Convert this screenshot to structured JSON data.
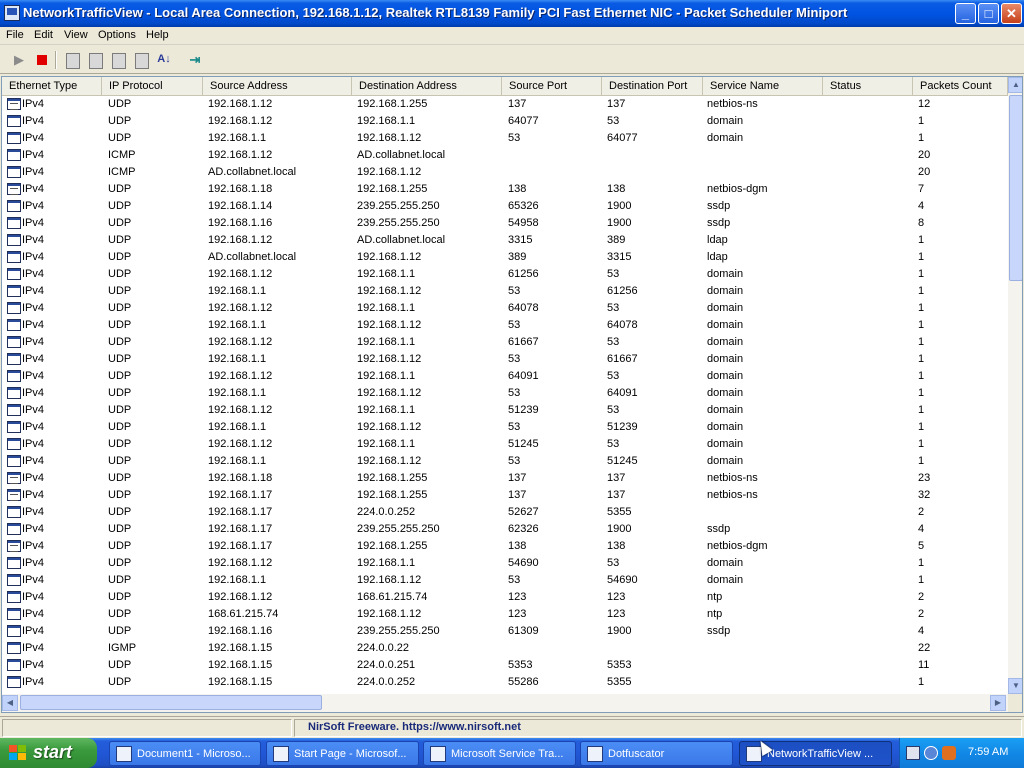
{
  "window": {
    "title": "NetworkTrafficView  -  Local Area Connection, 192.168.1.12, Realtek RTL8139 Family PCI Fast Ethernet NIC - Packet Scheduler Miniport",
    "minimize": "_",
    "maximize": "□",
    "close": "✕"
  },
  "menu": [
    "File",
    "Edit",
    "View",
    "Options",
    "Help"
  ],
  "toolbar": [
    "play-icon",
    "stop-icon",
    "save-icon",
    "copy-icon",
    "properties-icon",
    "html-report-icon",
    "sort-icon",
    "exit-icon"
  ],
  "columns": [
    "Ethernet Type",
    "IP Protocol",
    "Source Address",
    "Destination Address",
    "Source Port",
    "Destination Port",
    "Service Name",
    "Status",
    "Packets Count"
  ],
  "rows": [
    [
      "IPv4",
      "UDP",
      "192.168.1.12",
      "192.168.1.255",
      "137",
      "137",
      "netbios-ns",
      "",
      "12"
    ],
    [
      "IPv4",
      "UDP",
      "192.168.1.12",
      "192.168.1.1",
      "64077",
      "53",
      "domain",
      "",
      "1"
    ],
    [
      "IPv4",
      "UDP",
      "192.168.1.1",
      "192.168.1.12",
      "53",
      "64077",
      "domain",
      "",
      "1"
    ],
    [
      "IPv4",
      "ICMP",
      "192.168.1.12",
      "AD.collabnet.local",
      "",
      "",
      "",
      "",
      "20"
    ],
    [
      "IPv4",
      "ICMP",
      "AD.collabnet.local",
      "192.168.1.12",
      "",
      "",
      "",
      "",
      "20"
    ],
    [
      "IPv4",
      "UDP",
      "192.168.1.18",
      "192.168.1.255",
      "138",
      "138",
      "netbios-dgm",
      "",
      "7"
    ],
    [
      "IPv4",
      "UDP",
      "192.168.1.14",
      "239.255.255.250",
      "65326",
      "1900",
      "ssdp",
      "",
      "4"
    ],
    [
      "IPv4",
      "UDP",
      "192.168.1.16",
      "239.255.255.250",
      "54958",
      "1900",
      "ssdp",
      "",
      "8"
    ],
    [
      "IPv4",
      "UDP",
      "192.168.1.12",
      "AD.collabnet.local",
      "3315",
      "389",
      "ldap",
      "",
      "1"
    ],
    [
      "IPv4",
      "UDP",
      "AD.collabnet.local",
      "192.168.1.12",
      "389",
      "3315",
      "ldap",
      "",
      "1"
    ],
    [
      "IPv4",
      "UDP",
      "192.168.1.12",
      "192.168.1.1",
      "61256",
      "53",
      "domain",
      "",
      "1"
    ],
    [
      "IPv4",
      "UDP",
      "192.168.1.1",
      "192.168.1.12",
      "53",
      "61256",
      "domain",
      "",
      "1"
    ],
    [
      "IPv4",
      "UDP",
      "192.168.1.12",
      "192.168.1.1",
      "64078",
      "53",
      "domain",
      "",
      "1"
    ],
    [
      "IPv4",
      "UDP",
      "192.168.1.1",
      "192.168.1.12",
      "53",
      "64078",
      "domain",
      "",
      "1"
    ],
    [
      "IPv4",
      "UDP",
      "192.168.1.12",
      "192.168.1.1",
      "61667",
      "53",
      "domain",
      "",
      "1"
    ],
    [
      "IPv4",
      "UDP",
      "192.168.1.1",
      "192.168.1.12",
      "53",
      "61667",
      "domain",
      "",
      "1"
    ],
    [
      "IPv4",
      "UDP",
      "192.168.1.12",
      "192.168.1.1",
      "64091",
      "53",
      "domain",
      "",
      "1"
    ],
    [
      "IPv4",
      "UDP",
      "192.168.1.1",
      "192.168.1.12",
      "53",
      "64091",
      "domain",
      "",
      "1"
    ],
    [
      "IPv4",
      "UDP",
      "192.168.1.12",
      "192.168.1.1",
      "51239",
      "53",
      "domain",
      "",
      "1"
    ],
    [
      "IPv4",
      "UDP",
      "192.168.1.1",
      "192.168.1.12",
      "53",
      "51239",
      "domain",
      "",
      "1"
    ],
    [
      "IPv4",
      "UDP",
      "192.168.1.12",
      "192.168.1.1",
      "51245",
      "53",
      "domain",
      "",
      "1"
    ],
    [
      "IPv4",
      "UDP",
      "192.168.1.1",
      "192.168.1.12",
      "53",
      "51245",
      "domain",
      "",
      "1"
    ],
    [
      "IPv4",
      "UDP",
      "192.168.1.18",
      "192.168.1.255",
      "137",
      "137",
      "netbios-ns",
      "",
      "23"
    ],
    [
      "IPv4",
      "UDP",
      "192.168.1.17",
      "192.168.1.255",
      "137",
      "137",
      "netbios-ns",
      "",
      "32"
    ],
    [
      "IPv4",
      "UDP",
      "192.168.1.17",
      "224.0.0.252",
      "52627",
      "5355",
      "",
      "",
      "2"
    ],
    [
      "IPv4",
      "UDP",
      "192.168.1.17",
      "239.255.255.250",
      "62326",
      "1900",
      "ssdp",
      "",
      "4"
    ],
    [
      "IPv4",
      "UDP",
      "192.168.1.17",
      "192.168.1.255",
      "138",
      "138",
      "netbios-dgm",
      "",
      "5"
    ],
    [
      "IPv4",
      "UDP",
      "192.168.1.12",
      "192.168.1.1",
      "54690",
      "53",
      "domain",
      "",
      "1"
    ],
    [
      "IPv4",
      "UDP",
      "192.168.1.1",
      "192.168.1.12",
      "53",
      "54690",
      "domain",
      "",
      "1"
    ],
    [
      "IPv4",
      "UDP",
      "192.168.1.12",
      "168.61.215.74",
      "123",
      "123",
      "ntp",
      "",
      "2"
    ],
    [
      "IPv4",
      "UDP",
      "168.61.215.74",
      "192.168.1.12",
      "123",
      "123",
      "ntp",
      "",
      "2"
    ],
    [
      "IPv4",
      "UDP",
      "192.168.1.16",
      "239.255.255.250",
      "61309",
      "1900",
      "ssdp",
      "",
      "4"
    ],
    [
      "IPv4",
      "IGMP",
      "192.168.1.15",
      "224.0.0.22",
      "",
      "",
      "",
      "",
      "22"
    ],
    [
      "IPv4",
      "UDP",
      "192.168.1.15",
      "224.0.0.251",
      "5353",
      "5353",
      "",
      "",
      "11"
    ],
    [
      "IPv4",
      "UDP",
      "192.168.1.15",
      "224.0.0.252",
      "55286",
      "5355",
      "",
      "",
      "1"
    ]
  ],
  "status": {
    "link": "NirSoft Freeware. https://www.nirsoft.net"
  },
  "taskbar": {
    "start": "start",
    "tasks": [
      "Document1 - Microso...",
      "Start Page - Microsof...",
      "Microsoft Service Tra...",
      "Dotfuscator",
      "NetworkTrafficView ..."
    ],
    "clock": "7:59 AM"
  },
  "colors": {
    "title_bar": "#0054e3",
    "start_button": "#3a9a3c",
    "taskbar": "#245edb",
    "stop": "#e00000"
  }
}
